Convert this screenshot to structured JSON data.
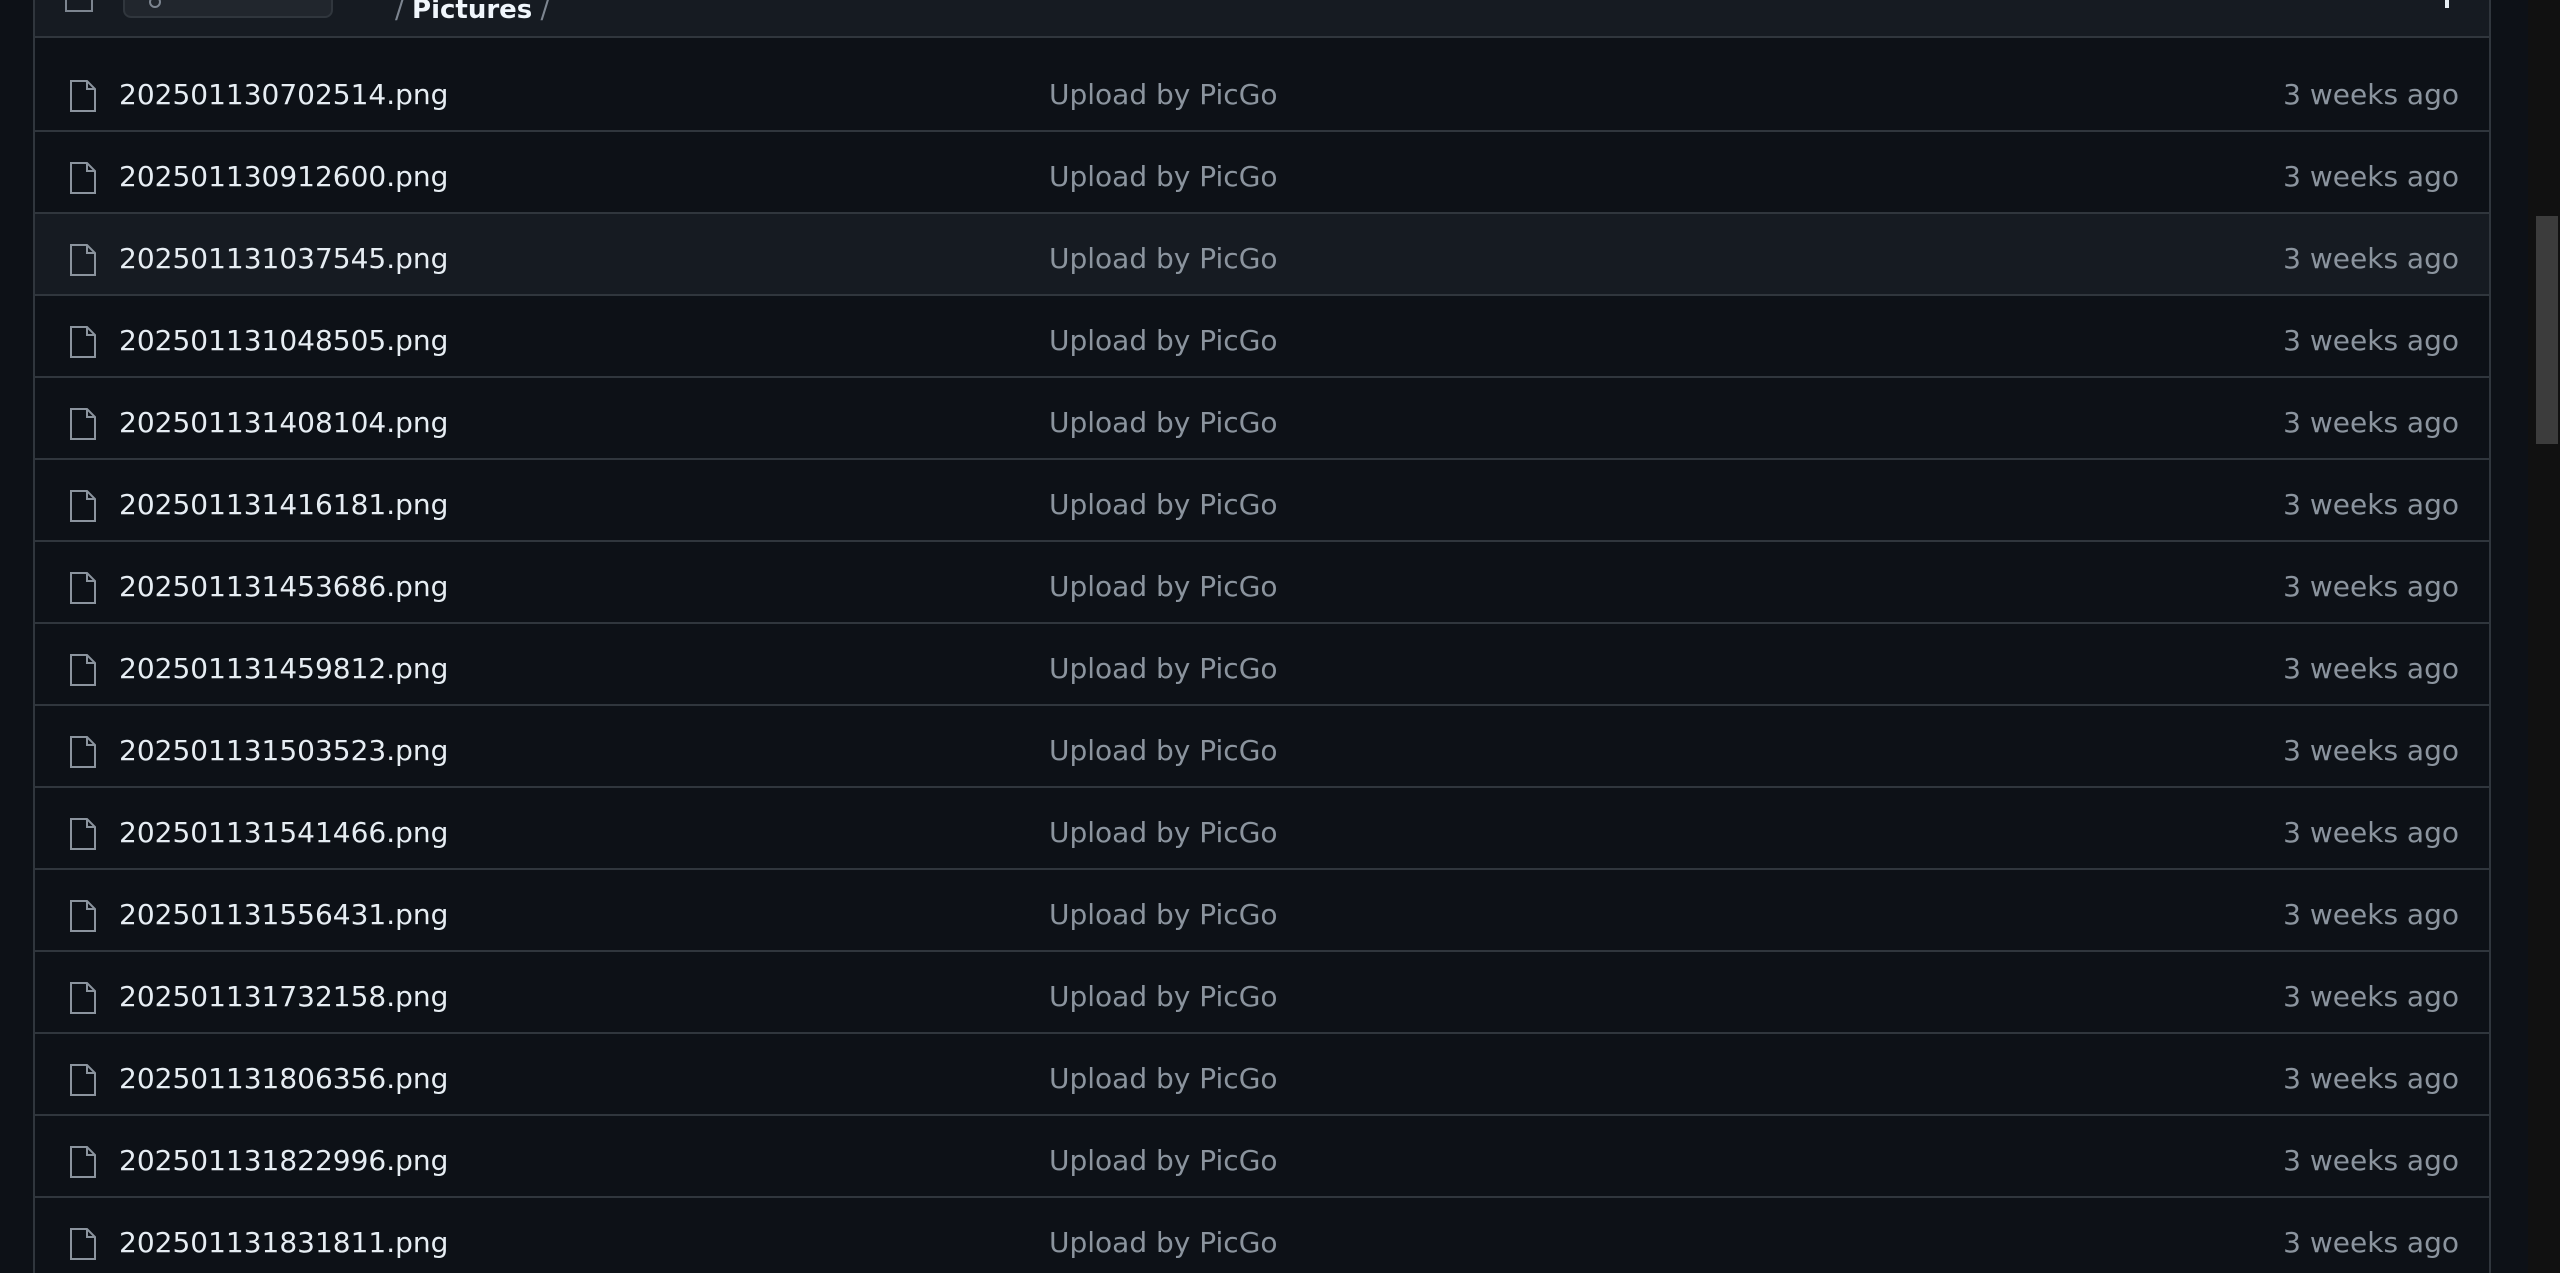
{
  "header": {
    "breadcrumb_sep_1": "/",
    "breadcrumb_current": "Pictures",
    "breadcrumb_sep_2": "/"
  },
  "files": [
    {
      "name": "202501130702514.png",
      "commit": "Upload by PicGo",
      "age": "3 weeks ago"
    },
    {
      "name": "202501130912600.png",
      "commit": "Upload by PicGo",
      "age": "3 weeks ago"
    },
    {
      "name": "202501131037545.png",
      "commit": "Upload by PicGo",
      "age": "3 weeks ago"
    },
    {
      "name": "202501131048505.png",
      "commit": "Upload by PicGo",
      "age": "3 weeks ago"
    },
    {
      "name": "202501131408104.png",
      "commit": "Upload by PicGo",
      "age": "3 weeks ago"
    },
    {
      "name": "202501131416181.png",
      "commit": "Upload by PicGo",
      "age": "3 weeks ago"
    },
    {
      "name": "202501131453686.png",
      "commit": "Upload by PicGo",
      "age": "3 weeks ago"
    },
    {
      "name": "202501131459812.png",
      "commit": "Upload by PicGo",
      "age": "3 weeks ago"
    },
    {
      "name": "202501131503523.png",
      "commit": "Upload by PicGo",
      "age": "3 weeks ago"
    },
    {
      "name": "202501131541466.png",
      "commit": "Upload by PicGo",
      "age": "3 weeks ago"
    },
    {
      "name": "202501131556431.png",
      "commit": "Upload by PicGo",
      "age": "3 weeks ago"
    },
    {
      "name": "202501131732158.png",
      "commit": "Upload by PicGo",
      "age": "3 weeks ago"
    },
    {
      "name": "202501131806356.png",
      "commit": "Upload by PicGo",
      "age": "3 weeks ago"
    },
    {
      "name": "202501131822996.png",
      "commit": "Upload by PicGo",
      "age": "3 weeks ago"
    },
    {
      "name": "202501131831811.png",
      "commit": "Upload by PicGo",
      "age": "3 weeks ago"
    }
  ],
  "icons": {
    "file_row_icon": "file-icon"
  },
  "colors": {
    "background": "#0d1117",
    "border": "#30363d",
    "text_primary": "#e6edf3",
    "text_muted": "#8b949e",
    "hover_row": "#161b22"
  }
}
